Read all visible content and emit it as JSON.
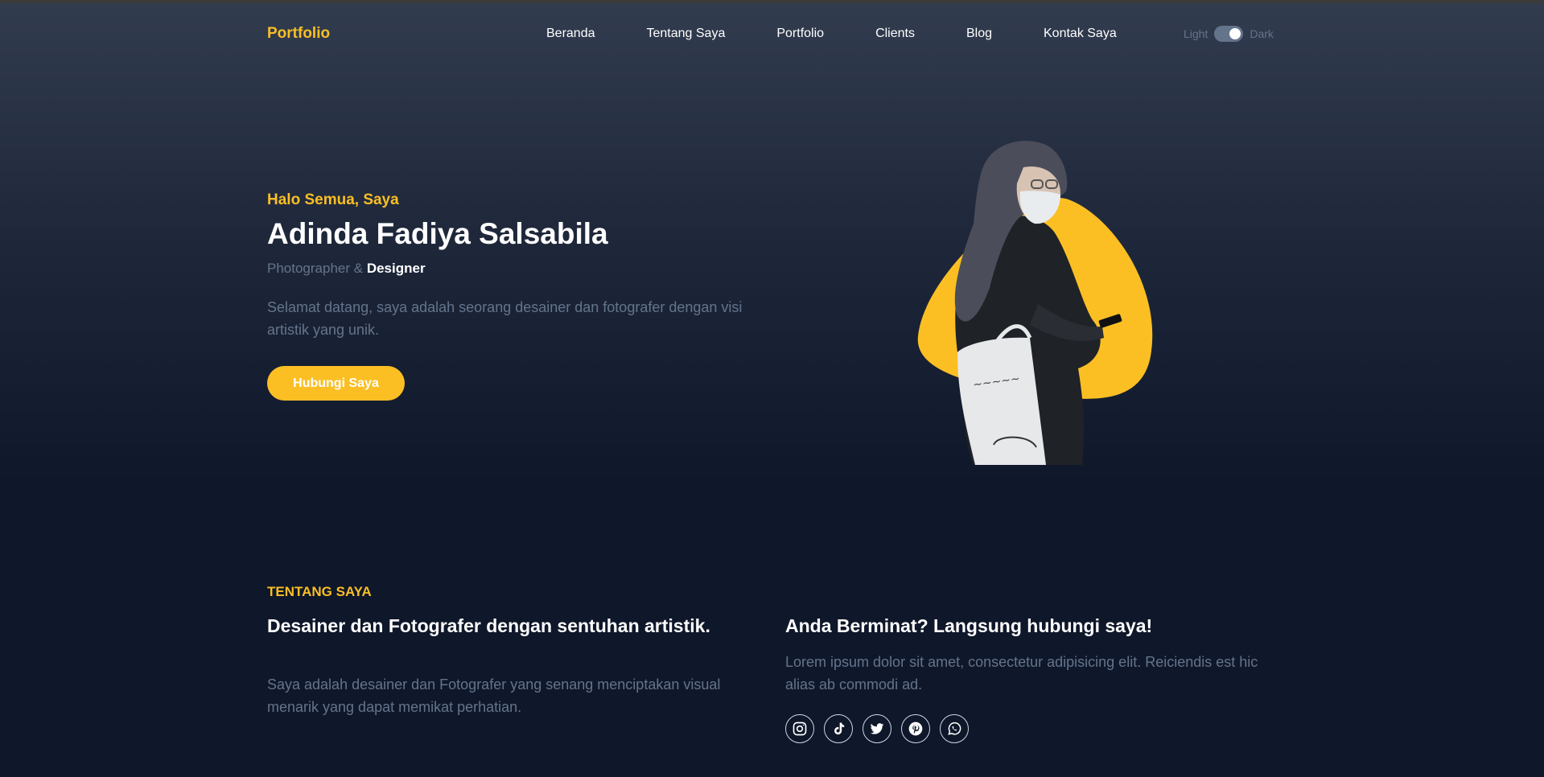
{
  "nav": {
    "brand": "Portfolio",
    "links": [
      "Beranda",
      "Tentang Saya",
      "Portfolio",
      "Clients",
      "Blog",
      "Kontak Saya"
    ],
    "toggle": {
      "light_label": "Light",
      "dark_label": "Dark",
      "state": "dark"
    }
  },
  "hero": {
    "greeting": "Halo Semua, Saya",
    "name": "Adinda Fadiya Salsabila",
    "role_prefix": "Photographer &",
    "role_highlight": "Designer",
    "description": "Selamat datang, saya adalah seorang desainer dan fotografer dengan visi artistik yang unik.",
    "cta_label": "Hubungi Saya"
  },
  "about": {
    "label": "TENTANG SAYA",
    "title": "Desainer dan Fotografer dengan sentuhan artistik.",
    "description": "Saya adalah desainer dan Fotografer yang senang menciptakan visual menarik yang dapat memikat perhatian."
  },
  "contact": {
    "title": "Anda Berminat? Langsung hubungi saya!",
    "description": "Lorem ipsum dolor sit amet, consectetur adipisicing elit. Reiciendis est hic alias ab commodi ad.",
    "socials": [
      "instagram-icon",
      "tiktok-icon",
      "twitter-icon",
      "pinterest-icon",
      "whatsapp-icon"
    ]
  },
  "colors": {
    "accent": "#fbbf24",
    "background": "#0f172a",
    "muted_text": "#64748b"
  }
}
